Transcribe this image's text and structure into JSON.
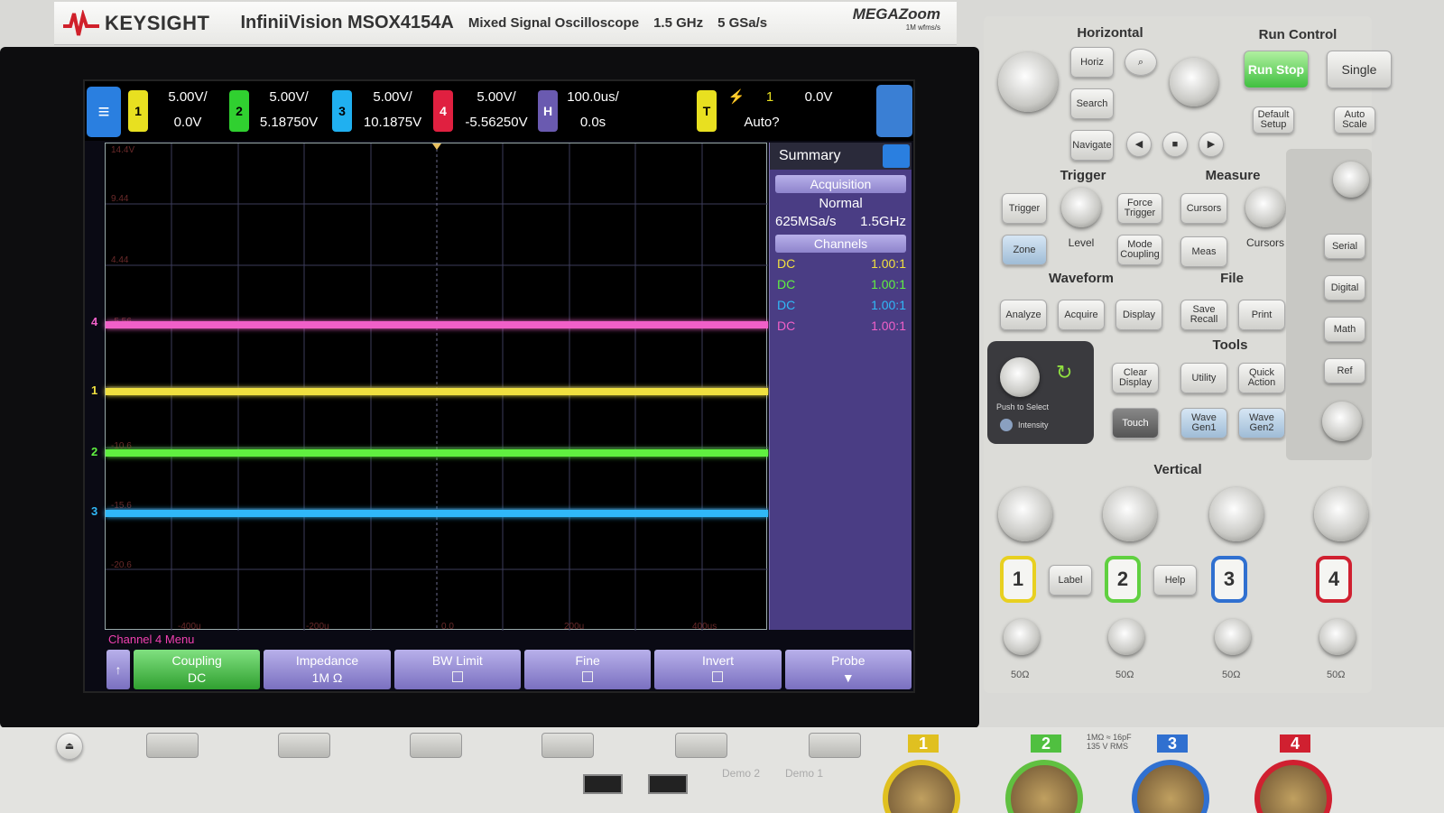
{
  "header": {
    "brand": "KEYSIGHT",
    "model": "InfiniiVision MSOX4154A",
    "description": "Mixed Signal Oscilloscope",
    "bandwidth": "1.5 GHz",
    "sample_rate": "5 GSa/s",
    "megazoom": "MEGAZoom",
    "megazoom_sub": "1M wfms/s"
  },
  "status": {
    "ch1": {
      "num": "1",
      "scale": "5.00V/",
      "offset": "0.0V",
      "color": "#e8e020"
    },
    "ch2": {
      "num": "2",
      "scale": "5.00V/",
      "offset": "5.18750V",
      "color": "#30d030"
    },
    "ch3": {
      "num": "3",
      "scale": "5.00V/",
      "offset": "10.1875V",
      "color": "#20b0f0"
    },
    "ch4": {
      "num": "4",
      "scale": "5.00V/",
      "offset": "-5.56250V",
      "color": "#e02040"
    },
    "horiz": {
      "label": "H",
      "scale": "100.0us/",
      "delay": "0.0s"
    },
    "trigger": {
      "label": "T",
      "source": "1",
      "level": "0.0V",
      "mode": "Auto?"
    }
  },
  "graticule": {
    "y_labels": [
      "14.4V",
      "9.44",
      "4.44",
      "-5.56",
      "-10.6",
      "-15.6",
      "-20.6"
    ],
    "x_labels": [
      "-400u",
      "-200u",
      "0.0",
      "200u",
      "400us"
    ]
  },
  "summary": {
    "title": "Summary",
    "acquisition_label": "Acquisition",
    "mode": "Normal",
    "sample_rate": "625MSa/s",
    "bandwidth": "1.5GHz",
    "channels_label": "Channels",
    "channels": [
      {
        "coupling": "DC",
        "probe": "1.00:1"
      },
      {
        "coupling": "DC",
        "probe": "1.00:1"
      },
      {
        "coupling": "DC",
        "probe": "1.00:1"
      },
      {
        "coupling": "DC",
        "probe": "1.00:1"
      }
    ]
  },
  "softkeys": {
    "menu_title": "Channel 4 Menu",
    "coupling": {
      "label": "Coupling",
      "value": "DC"
    },
    "impedance": {
      "label": "Impedance",
      "value": "1M Ω"
    },
    "bw_limit": "BW Limit",
    "fine": "Fine",
    "invert": "Invert",
    "probe": "Probe"
  },
  "panel": {
    "horizontal": "Horizontal",
    "run_control": "Run Control",
    "horiz_btn": "Horiz",
    "search_btn": "Search",
    "navigate_btn": "Navigate",
    "run_stop": "Run Stop",
    "single": "Single",
    "default_setup": "Default Setup",
    "auto_scale": "Auto Scale",
    "trigger": "Trigger",
    "measure": "Measure",
    "trigger_btn": "Trigger",
    "force_trigger": "Force Trigger",
    "cursors_btn": "Cursors",
    "zone": "Zone",
    "level": "Level",
    "mode_coupling": "Mode Coupling",
    "meas": "Meas",
    "cursors_knob": "Cursors",
    "waveform": "Waveform",
    "file": "File",
    "analyze": "Analyze",
    "acquire": "Acquire",
    "display": "Display",
    "save_recall": "Save Recall",
    "print": "Print",
    "tools": "Tools",
    "push_to_select": "Push to Select",
    "intensity": "Intensity",
    "clear_display": "Clear Display",
    "utility": "Utility",
    "quick_action": "Quick Action",
    "touch": "Touch",
    "wave_gen1": "Wave Gen1",
    "wave_gen2": "Wave Gen2",
    "serial": "Serial",
    "digital": "Digital",
    "math": "Math",
    "ref": "Ref",
    "vertical": "Vertical",
    "label": "Label",
    "help": "Help",
    "impedance_label": "50Ω"
  },
  "front": {
    "ch_labels": [
      "1",
      "2",
      "3",
      "4"
    ],
    "input_spec": "1MΩ ≈ 16pF 135 V RMS",
    "demo1": "Demo 1",
    "demo2": "Demo 2"
  }
}
